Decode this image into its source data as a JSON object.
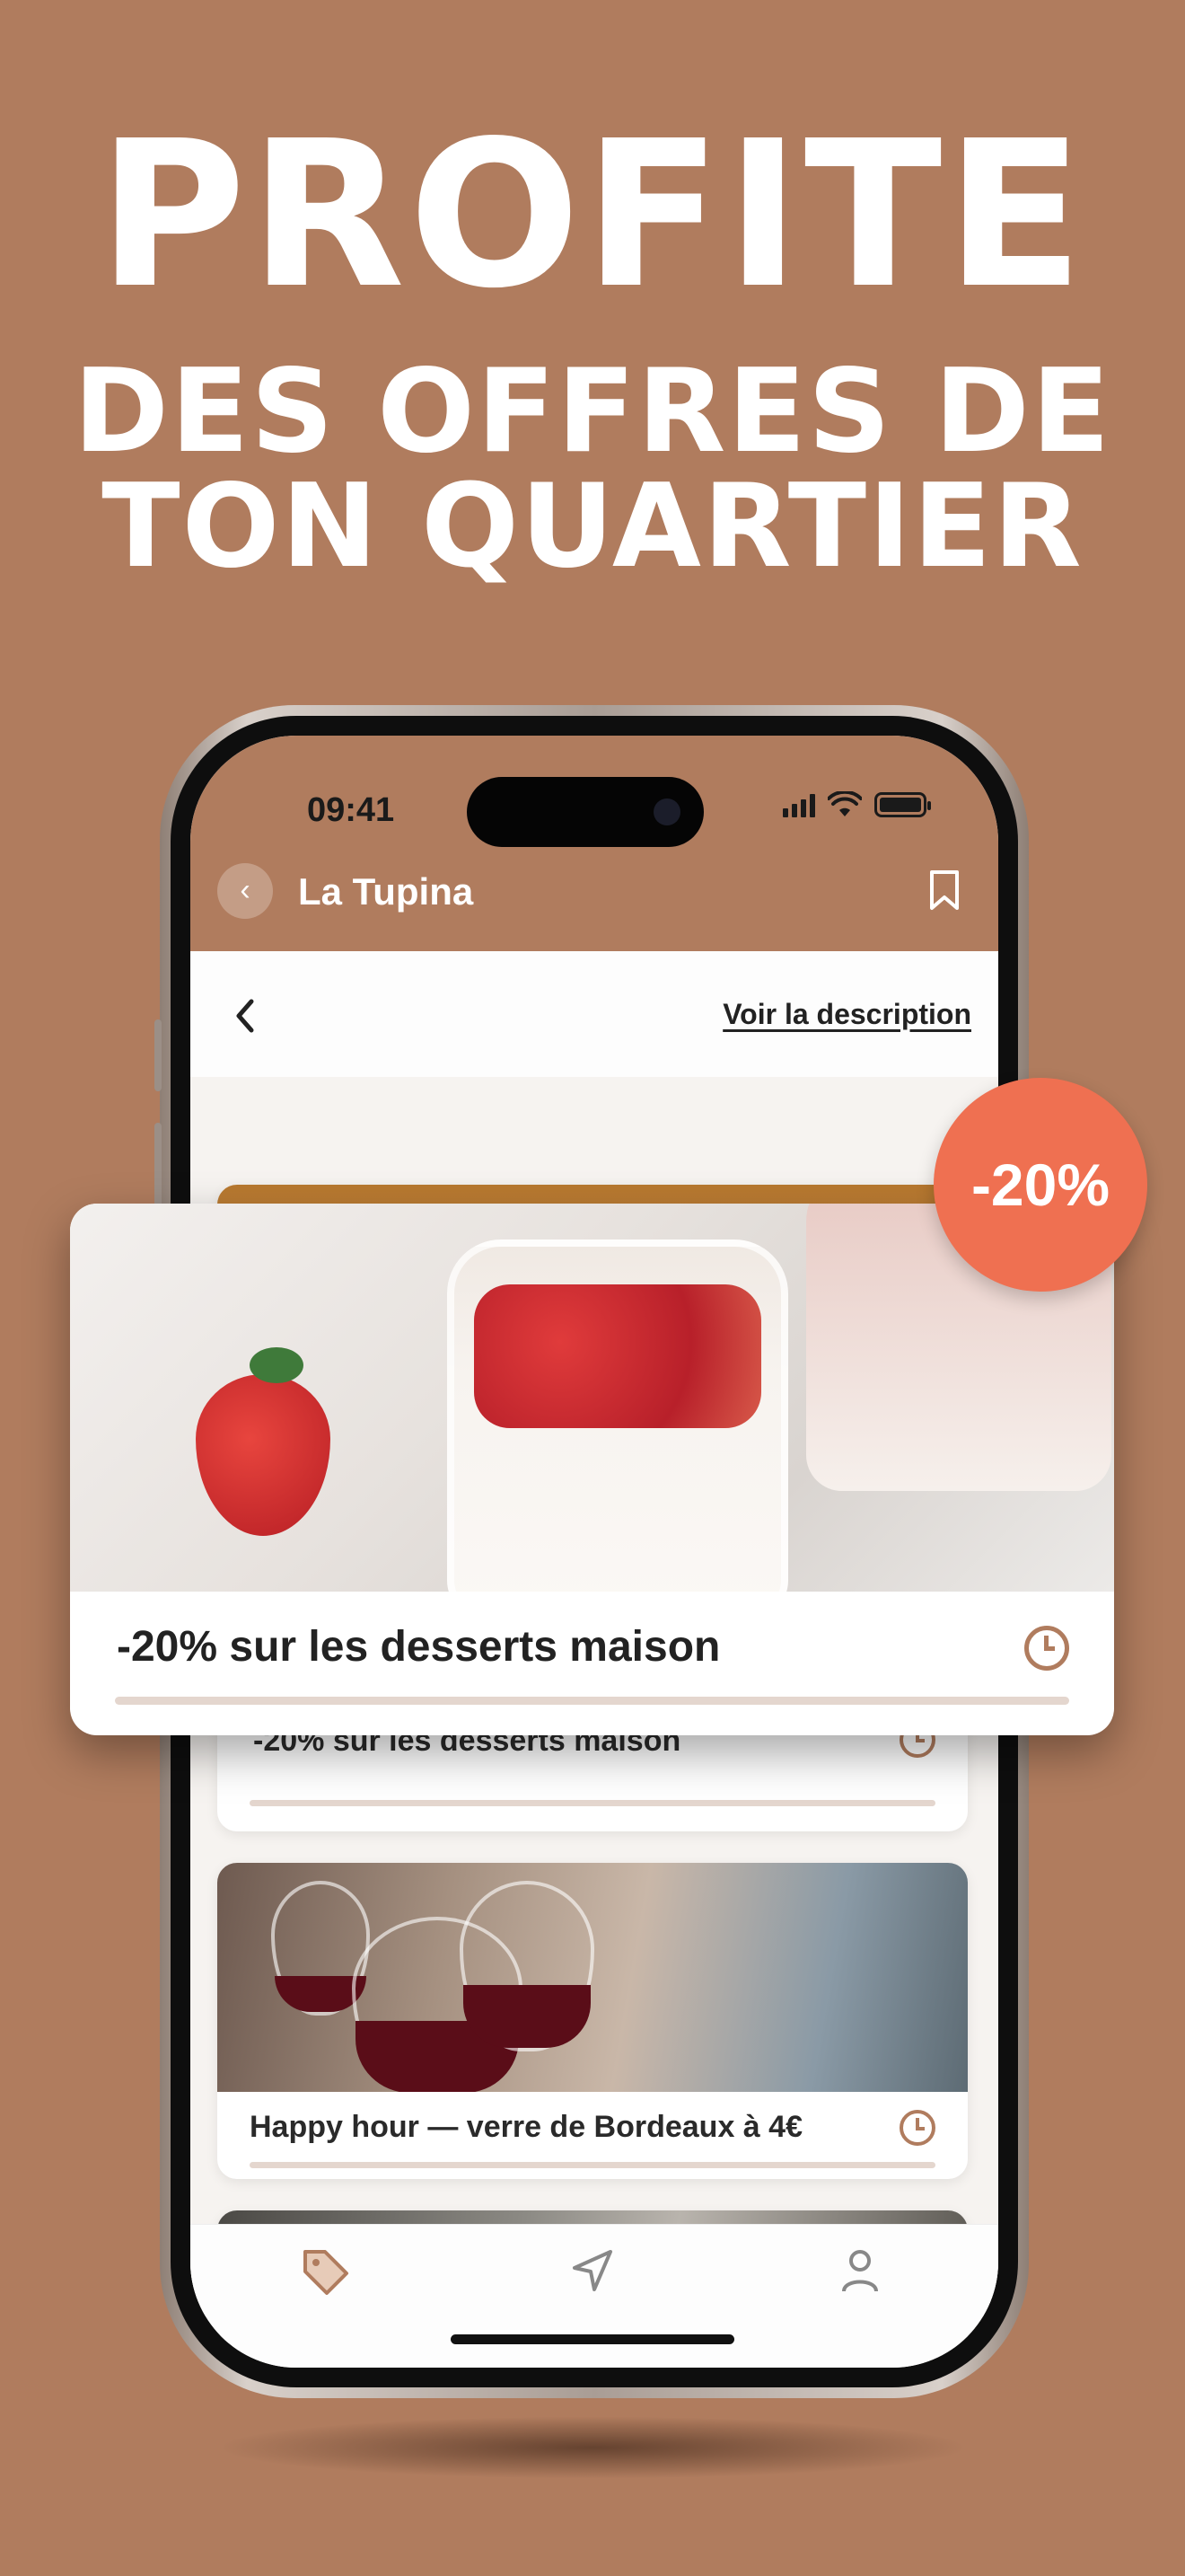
{
  "promo": {
    "headline": "PROFITE",
    "subheadline_line1": "DES OFFRES DE",
    "subheadline_line2": "TON QUARTIER"
  },
  "status_bar": {
    "time": "09:41"
  },
  "header": {
    "title": "La Tupina",
    "back_icon": "chevron-left-icon",
    "bookmark_icon": "bookmark-icon"
  },
  "subbar": {
    "link_label": "Voir la description"
  },
  "offers": [
    {
      "title": "-20% sur les desserts maison",
      "icon": "clock-icon"
    },
    {
      "title": "Happy hour — verre de Bordeaux à 4€",
      "icon": "clock-icon"
    }
  ],
  "featured": {
    "title": "-20% sur les desserts maison",
    "badge": "-20%",
    "icon": "clock-icon"
  },
  "tabbar": {
    "tabs": [
      "tag-icon",
      "location-arrow-icon",
      "user-icon"
    ]
  },
  "colors": {
    "brand": "#b07c5e",
    "badge": "#ef7051"
  }
}
